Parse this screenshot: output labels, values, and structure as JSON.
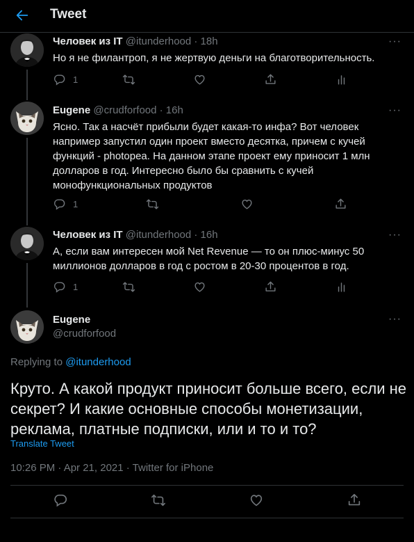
{
  "header": {
    "title": "Tweet"
  },
  "tweets": [
    {
      "name": "Человек из IT",
      "handle": "@itunderhood · 18h",
      "text": "Но я не филантроп, я не жертвую деньги на благотворительность.",
      "reply_count": "1"
    },
    {
      "name": "Eugene",
      "handle": "@crudforfood · 16h",
      "text": "Ясно. Так а насчёт прибыли будет какая-то инфа? Вот человек например запустил один проект вместо десятка, причем с кучей функций - photopea. На данном этапе проект ему приносит 1 млн долларов в год. Интересно было бы сравнить с кучей монофункциональных продуктов",
      "reply_count": "1"
    },
    {
      "name": "Человек из IT",
      "handle": "@itunderhood · 16h",
      "text": "А, если вам интересен мой Net Revenue — то он плюс-минус 50 миллионов долларов в год с ростом в 20-30 процентов в год.",
      "reply_count": "1"
    }
  ],
  "focus": {
    "name": "Eugene",
    "handle": "@crudforfood",
    "replying_prefix": "Replying to",
    "replying_to": "@itunderhood",
    "text": "Круто. А какой продукт приносит больше всего, если не секрет? И какие основные способы монетизации, реклама, платные подписки, или и то и то?",
    "translate": "Translate Tweet",
    "meta": "10:26 PM · Apr 21, 2021 · Twitter for iPhone"
  },
  "more_label": "···",
  "colors": {
    "accent": "#1d9bf0",
    "muted": "#71767b",
    "background": "#000000"
  }
}
